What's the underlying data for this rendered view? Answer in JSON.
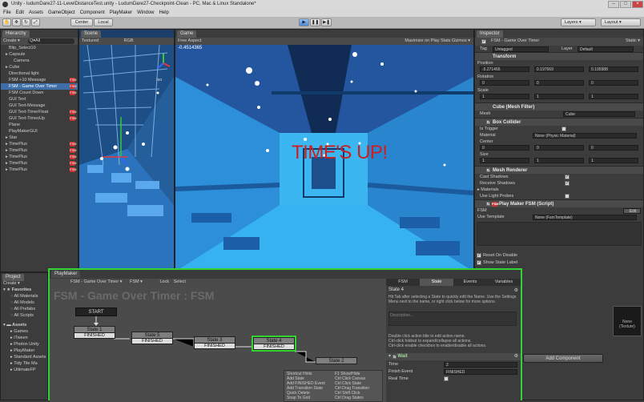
{
  "window": {
    "title": "Unity - ludumDare27-11-LevelDistanceTest.unity - LudumDare27-Checkpoint-Clean - PC, Mac & Linux Standalone*"
  },
  "menu": [
    "File",
    "Edit",
    "Assets",
    "GameObject",
    "Component",
    "PlayMaker",
    "Window",
    "Help"
  ],
  "toolbar": {
    "center": "Center",
    "local": "Local",
    "layers": "Layers",
    "layout": "Layout"
  },
  "hierarchy": {
    "tab": "Hierarchy",
    "create": "Create ▾",
    "search": "Q▾All",
    "items": [
      "Blip_Select10",
      "Capsule",
      "Camera",
      "Cube",
      "Directional light",
      "FSM +10 Message",
      "FSM - Game Over Timer",
      "FSM Count Down",
      "GUI Text",
      "GUI Text-Message",
      "GUI Text-TimerFloat",
      "GUI Text-TimesUp",
      "Plane",
      "PlayMakerGUI",
      "Star",
      "TimePlus",
      "TimePlus",
      "TimePlus",
      "TimePlus",
      "TimePlus"
    ]
  },
  "scene": {
    "tab": "Scene",
    "shading": "Textured",
    "mode": "RGB",
    "iso": "Iso"
  },
  "game": {
    "tab": "Game",
    "aspect": "Free Aspect",
    "toggles": "Maximize on Play  Stats  Gizmos ▾",
    "readout": "-0.4514365",
    "message": "TIME'S UP!"
  },
  "inspector": {
    "tab": "Inspector",
    "object": "FSM - Game Over Timer",
    "static": "Static ▾",
    "tag_label": "Tag",
    "tag": "Untagged",
    "layer_label": "Layer",
    "layer": "Default",
    "transform": {
      "title": "Transform",
      "position": "Position",
      "px": "-5.271466",
      "py": "0.197569",
      "pz": "0.195988",
      "rotation": "Rotation",
      "rx": "0",
      "ry": "0",
      "rz": "0",
      "scale": "Scale",
      "sx": "1",
      "sy": "1",
      "sz": "1"
    },
    "mesh_filter": {
      "title": "Cube (Mesh Filter)",
      "mesh_label": "Mesh",
      "mesh": "Cube"
    },
    "box_collider": {
      "title": "Box Collider",
      "trigger": "Is Trigger",
      "material_label": "Material",
      "material": "None (Physic Material)",
      "center": "Center",
      "cx": "0",
      "cy": "0",
      "cz": "0",
      "size": "Size",
      "szx": "1",
      "szy": "1",
      "szz": "1"
    },
    "mesh_renderer": {
      "title": "Mesh Renderer",
      "cast": "Cast Shadows",
      "receive": "Receive Shadows",
      "materials": "Materials",
      "light_probes": "Use Light Probes"
    },
    "playmaker": {
      "title": "Play Maker FSM (Script)",
      "fsm_label": "FSM",
      "edit": "Edit",
      "template_label": "Use Template",
      "template": "None (FsmTemplate)",
      "reset": "Reset On Disable",
      "show_state": "Show State Label"
    },
    "add_component": "Add Component",
    "material_preview": "None\n(Texture)"
  },
  "project": {
    "tab": "Project",
    "create": "Create ▾",
    "favorites": "Favorites",
    "fav_items": [
      "All Materials",
      "All Models",
      "All Prefabs",
      "All Scripts"
    ],
    "assets": "Assets",
    "asset_items": [
      "Games",
      "iTween",
      "Photon Unity",
      "PlayMaker",
      "Standard Assets",
      "Tidy Tile Ma",
      "UltimateFP"
    ]
  },
  "playmaker": {
    "tab": "PlayMaker",
    "fsm_select": "FSM - Game Over Timer ▾",
    "fsm_select2": "FSM ▾",
    "lock": "Lock",
    "select": "Select",
    "title": "FSM - Game Over Timer : FSM",
    "start": "START",
    "states": [
      {
        "name": "State 1",
        "event": "FINISHED"
      },
      {
        "name": "State 5",
        "event": "FINISHED"
      },
      {
        "name": "State 3",
        "event": "FINISHED"
      },
      {
        "name": "State 4",
        "event": "FINISHED"
      },
      {
        "name": "State 2",
        "event": ""
      }
    ],
    "tabs": [
      "FSM",
      "State",
      "Events",
      "Variables"
    ],
    "state_name": "State 4",
    "hint": "Hit Tab after selecting a State to quickly edit the Name. Use the Settings Menu next to the name, or right click below for more options.",
    "description": "Description...",
    "action_hint": "Double click action title to edit action name.\nCtrl-click foldout to expand/collapse all actions.\nCtrl-click enable checkbox to enable/disable all actions.",
    "action": {
      "title": "Wait",
      "time_label": "Time",
      "time": "2",
      "finish_label": "Finish Event",
      "finish": "FINISHED",
      "real_label": "Real Time"
    },
    "shortcuts": [
      [
        "Shortcut Hints",
        "F1 Show/Hide"
      ],
      [
        "Add State",
        "Ctrl Click Canvas"
      ],
      [
        "Add FINISHED Event",
        "Ctrl Click State"
      ],
      [
        "Add Transition State",
        "Ctrl Drag Transition"
      ],
      [
        "Quick Delete",
        "Ctrl Shift Click"
      ],
      [
        "Snap To Grid",
        "Ctrl Drag States"
      ]
    ]
  },
  "colors": {
    "scene_blue": "#2a70b5",
    "game_blue": "#2f9fe0",
    "times_up": "#cc2020",
    "fsm_red": "#cc3333",
    "selected_green": "#34d334"
  }
}
